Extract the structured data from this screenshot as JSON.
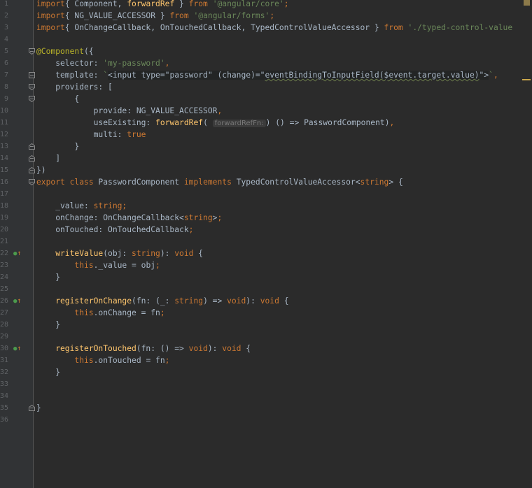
{
  "editor": {
    "language": "typescript",
    "colors": {
      "background": "#2b2b2b",
      "gutter": "#313335",
      "keyword": "#cc7832",
      "string": "#6a8759",
      "function": "#ffc66d",
      "annotation": "#bbb529",
      "text": "#a9b7c6"
    },
    "lines": [
      {
        "n": "1",
        "t": [
          [
            "kw",
            "import"
          ],
          [
            "",
            "{ Component, "
          ],
          [
            "fn",
            "forwardRef"
          ],
          [
            "",
            " } "
          ],
          [
            "kw",
            "from"
          ],
          [
            "",
            " "
          ],
          [
            "str",
            "'@angular/core'"
          ],
          [
            "kw",
            ";"
          ]
        ]
      },
      {
        "n": "2",
        "t": [
          [
            "kw",
            "import"
          ],
          [
            "",
            "{ NG_VALUE_ACCESSOR } "
          ],
          [
            "kw",
            "from"
          ],
          [
            "",
            " "
          ],
          [
            "str",
            "'@angular/forms'"
          ],
          [
            "kw",
            ";"
          ]
        ]
      },
      {
        "n": "3",
        "t": [
          [
            "kw",
            "import"
          ],
          [
            "",
            "{ OnChangeCallback, OnTouchedCallback, TypedControlValueAccessor } "
          ],
          [
            "kw",
            "from"
          ],
          [
            "",
            " "
          ],
          [
            "str",
            "'./typed-control-value"
          ]
        ]
      },
      {
        "n": "4",
        "t": []
      },
      {
        "n": "5",
        "t": [
          [
            "ann",
            "@Component"
          ],
          [
            "",
            "({"
          ]
        ]
      },
      {
        "n": "6",
        "t": [
          [
            "",
            "    selector: "
          ],
          [
            "str",
            "'my-password'"
          ],
          [
            "kw",
            ","
          ]
        ]
      },
      {
        "n": "7",
        "t": [
          [
            "",
            "    template: "
          ],
          [
            "str",
            "`"
          ],
          [
            "tpl",
            "<input type=\"password\" (change)=\""
          ],
          [
            "squig",
            "eventBindingToInputField($event.target.value)"
          ],
          [
            "tpl",
            "\">"
          ],
          [
            "str",
            "`"
          ],
          [
            "kw",
            ","
          ]
        ]
      },
      {
        "n": "8",
        "t": [
          [
            "",
            "    providers: ["
          ]
        ]
      },
      {
        "n": "9",
        "t": [
          [
            "",
            "        {"
          ]
        ]
      },
      {
        "n": "10",
        "t": [
          [
            "",
            "            provide: NG_VALUE_ACCESSOR"
          ],
          [
            "kw",
            ","
          ]
        ]
      },
      {
        "n": "11",
        "t": [
          [
            "",
            "            useExisting: "
          ],
          [
            "fn",
            "forwardRef"
          ],
          [
            "",
            "( "
          ],
          [
            "hint",
            "forwardRefFn:"
          ],
          [
            "",
            ") () => PasswordComponent)"
          ],
          [
            "kw",
            ","
          ]
        ]
      },
      {
        "n": "12",
        "t": [
          [
            "",
            "            multi: "
          ],
          [
            "kw",
            "true"
          ]
        ]
      },
      {
        "n": "13",
        "t": [
          [
            "",
            "        }"
          ]
        ]
      },
      {
        "n": "14",
        "t": [
          [
            "",
            "    ]"
          ]
        ]
      },
      {
        "n": "15",
        "t": [
          [
            "",
            "})"
          ]
        ]
      },
      {
        "n": "16",
        "t": [
          [
            "kw",
            "export class "
          ],
          [
            "",
            "PasswordComponent "
          ],
          [
            "kw",
            "implements "
          ],
          [
            "",
            "TypedControlValueAccessor<"
          ],
          [
            "kw",
            "string"
          ],
          [
            "",
            "> {"
          ]
        ]
      },
      {
        "n": "17",
        "t": []
      },
      {
        "n": "18",
        "t": [
          [
            "",
            "    _value: "
          ],
          [
            "kw",
            "string;"
          ]
        ]
      },
      {
        "n": "19",
        "t": [
          [
            "",
            "    onChange: OnChangeCallback<"
          ],
          [
            "kw",
            "string"
          ],
          [
            "",
            ">"
          ],
          [
            "kw",
            ";"
          ]
        ]
      },
      {
        "n": "20",
        "t": [
          [
            "",
            "    onTouched: OnTouchedCallback"
          ],
          [
            "kw",
            ";"
          ]
        ]
      },
      {
        "n": "21",
        "t": []
      },
      {
        "n": "22",
        "t": [
          [
            "fn",
            "    writeValue"
          ],
          [
            "",
            "(obj: "
          ],
          [
            "kw",
            "string"
          ],
          [
            "",
            "): "
          ],
          [
            "kw",
            "void"
          ],
          [
            "",
            " {"
          ]
        ]
      },
      {
        "n": "23",
        "t": [
          [
            "kw",
            "        this"
          ],
          [
            "",
            "._value = obj"
          ],
          [
            "kw",
            ";"
          ]
        ]
      },
      {
        "n": "24",
        "t": [
          [
            "",
            "    }"
          ]
        ]
      },
      {
        "n": "25",
        "t": []
      },
      {
        "n": "26",
        "t": [
          [
            "fn",
            "    registerOnChange"
          ],
          [
            "",
            "(fn: (_: "
          ],
          [
            "kw",
            "string"
          ],
          [
            "",
            ") => "
          ],
          [
            "kw",
            "void"
          ],
          [
            "",
            "): "
          ],
          [
            "kw",
            "void"
          ],
          [
            "",
            " {"
          ]
        ]
      },
      {
        "n": "27",
        "t": [
          [
            "kw",
            "        this"
          ],
          [
            "",
            ".onChange = fn"
          ],
          [
            "kw",
            ";"
          ]
        ]
      },
      {
        "n": "28",
        "t": [
          [
            "",
            "    }"
          ]
        ]
      },
      {
        "n": "29",
        "t": []
      },
      {
        "n": "30",
        "t": [
          [
            "fn",
            "    registerOnTouched"
          ],
          [
            "",
            "(fn: () => "
          ],
          [
            "kw",
            "void"
          ],
          [
            "",
            "): "
          ],
          [
            "kw",
            "void"
          ],
          [
            "",
            " {"
          ]
        ]
      },
      {
        "n": "31",
        "t": [
          [
            "kw",
            "        this"
          ],
          [
            "",
            ".onTouched = fn"
          ],
          [
            "kw",
            ";"
          ]
        ]
      },
      {
        "n": "32",
        "t": [
          [
            "",
            "    }"
          ]
        ]
      },
      {
        "n": "33",
        "t": []
      },
      {
        "n": "34",
        "t": []
      },
      {
        "n": "35",
        "t": [
          [
            "",
            "}"
          ]
        ]
      },
      {
        "n": "36",
        "t": []
      }
    ],
    "override_lines": [
      "22",
      "26",
      "30"
    ],
    "fold_lines": {
      "open": [
        "5",
        "8",
        "9",
        "16"
      ],
      "close": [
        "13",
        "14",
        "15",
        "35"
      ],
      "both": [
        "7"
      ]
    },
    "icons": {
      "override": "override-implements-icon",
      "fold": "fold-marker-icon"
    }
  }
}
